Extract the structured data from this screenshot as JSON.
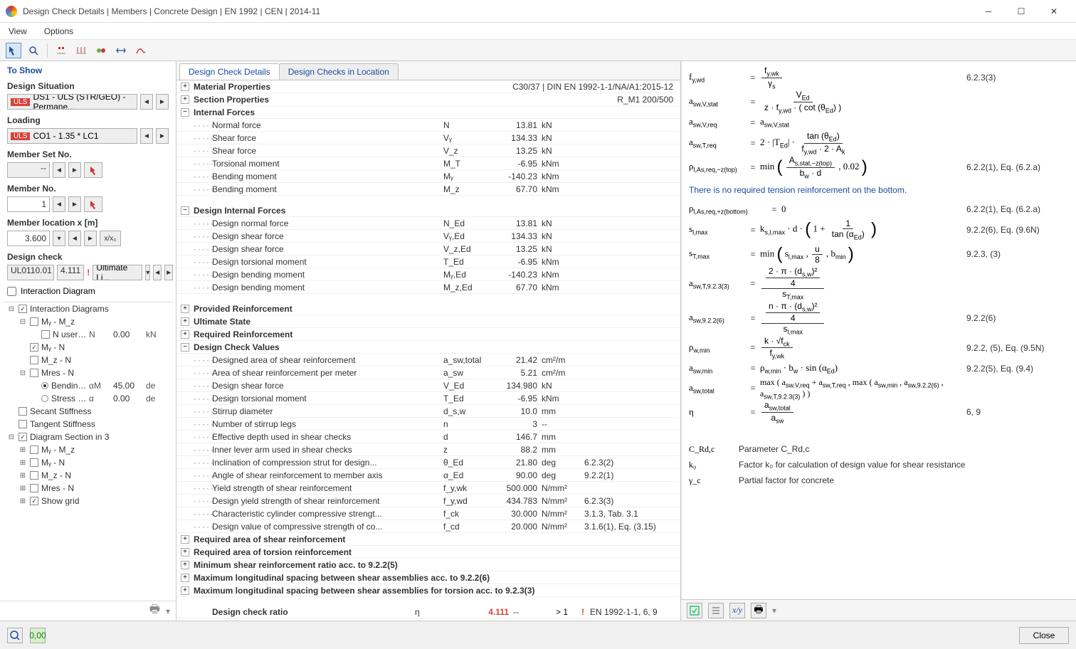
{
  "window": {
    "title": "Design Check Details | Members | Concrete Design | EN 1992 | CEN | 2014-11",
    "menu": {
      "view": "View",
      "options": "Options"
    },
    "close_label": "Close"
  },
  "left": {
    "header": "To Show",
    "design_situation_label": "Design Situation",
    "ds_badge": "ULS",
    "ds_value": "DS1 - ULS (STR/GEO) - Permane...",
    "loading_label": "Loading",
    "co_badge": "ULS",
    "co_value": "CO1 - 1.35 * LC1",
    "member_set_label": "Member Set No.",
    "member_set_value": "--",
    "member_no_label": "Member No.",
    "member_no_value": "1",
    "member_loc_label": "Member location x [m]",
    "member_loc_value": "3.600",
    "member_loc_btn": "x/x₀",
    "design_check_label": "Design check",
    "dc_code": "UL0110.01",
    "dc_ratio": "4.111",
    "dc_type": "Ultimate Li...",
    "interaction_label": "Interaction Diagram",
    "tree": [
      {
        "indent": 0,
        "exp": "-",
        "cbx": "checked",
        "label": "Interaction Diagrams"
      },
      {
        "indent": 1,
        "exp": "-",
        "cbx": "",
        "label": "Mᵧ - M_z"
      },
      {
        "indent": 2,
        "exp": "",
        "cbx": "",
        "label": "N user-defined",
        "c1": "N",
        "c2": "0.00",
        "c3": "kN"
      },
      {
        "indent": 1,
        "exp": "",
        "cbx": "checked",
        "label": "Mᵧ - N"
      },
      {
        "indent": 1,
        "exp": "",
        "cbx": "",
        "label": "M_z - N"
      },
      {
        "indent": 1,
        "exp": "-",
        "cbx": "",
        "label": "Mres - N"
      },
      {
        "indent": 2,
        "exp": "",
        "rad": "checked",
        "label": "Bending mom",
        "c1": "αM",
        "c2": "45.00",
        "c3": "de"
      },
      {
        "indent": 2,
        "exp": "",
        "rad": "",
        "label": "Stress plane a",
        "c1": "α",
        "c2": "0.00",
        "c3": "de"
      },
      {
        "indent": 0,
        "exp": "",
        "cbx": "",
        "label": "Secant Stiffness"
      },
      {
        "indent": 0,
        "exp": "",
        "cbx": "",
        "label": "Tangent Stiffness"
      },
      {
        "indent": 0,
        "exp": "-",
        "cbx": "checked",
        "label": "Diagram Section in 3"
      },
      {
        "indent": 1,
        "exp": "+",
        "cbx": "",
        "label": "Mᵧ - M_z"
      },
      {
        "indent": 1,
        "exp": "+",
        "cbx": "",
        "label": "Mᵧ - N"
      },
      {
        "indent": 1,
        "exp": "+",
        "cbx": "",
        "label": "M_z - N"
      },
      {
        "indent": 1,
        "exp": "+",
        "cbx": "",
        "label": "Mres - N"
      },
      {
        "indent": 1,
        "exp": "+",
        "cbx": "checked",
        "label": "Show grid"
      }
    ]
  },
  "mid": {
    "tabs": {
      "t1": "Design Check Details",
      "t2": "Design Checks in Location"
    },
    "hdr_material": "Material Properties",
    "hdr_material_info": "C30/37 | DIN EN 1992-1-1/NA/A1:2015-12",
    "hdr_section": "Section Properties",
    "hdr_section_info": "R_M1 200/500",
    "hdr_internal": "Internal Forces",
    "internal": [
      {
        "name": "Normal force",
        "sym": "N",
        "val": "13.81",
        "unit": "kN",
        "ref": ""
      },
      {
        "name": "Shear force",
        "sym": "Vᵧ",
        "val": "134.33",
        "unit": "kN",
        "ref": ""
      },
      {
        "name": "Shear force",
        "sym": "V_z",
        "val": "13.25",
        "unit": "kN",
        "ref": ""
      },
      {
        "name": "Torsional moment",
        "sym": "M_T",
        "val": "-6.95",
        "unit": "kNm",
        "ref": ""
      },
      {
        "name": "Bending moment",
        "sym": "Mᵧ",
        "val": "-140.23",
        "unit": "kNm",
        "ref": ""
      },
      {
        "name": "Bending moment",
        "sym": "M_z",
        "val": "67.70",
        "unit": "kNm",
        "ref": ""
      }
    ],
    "hdr_design_internal": "Design Internal Forces",
    "design_internal": [
      {
        "name": "Design normal force",
        "sym": "N_Ed",
        "val": "13.81",
        "unit": "kN",
        "ref": ""
      },
      {
        "name": "Design shear force",
        "sym": "Vᵧ,Ed",
        "val": "134.33",
        "unit": "kN",
        "ref": ""
      },
      {
        "name": "Design shear force",
        "sym": "V_z,Ed",
        "val": "13.25",
        "unit": "kN",
        "ref": ""
      },
      {
        "name": "Design torsional moment",
        "sym": "T_Ed",
        "val": "-6.95",
        "unit": "kNm",
        "ref": ""
      },
      {
        "name": "Design bending moment",
        "sym": "Mᵧ,Ed",
        "val": "-140.23",
        "unit": "kNm",
        "ref": ""
      },
      {
        "name": "Design bending moment",
        "sym": "M_z,Ed",
        "val": "67.70",
        "unit": "kNm",
        "ref": ""
      }
    ],
    "hdr_provided": "Provided Reinforcement",
    "hdr_ultimate": "Ultimate State",
    "hdr_required": "Required Reinforcement",
    "hdr_values": "Design Check Values",
    "values": [
      {
        "name": "Designed area of shear reinforcement",
        "sym": "a_sw,total",
        "val": "21.42",
        "unit": "cm²/m",
        "ref": ""
      },
      {
        "name": "Area of shear reinforcement per meter",
        "sym": "a_sw",
        "val": "5.21",
        "unit": "cm²/m",
        "ref": ""
      },
      {
        "name": "Design shear force",
        "sym": "V_Ed",
        "val": "134.980",
        "unit": "kN",
        "ref": ""
      },
      {
        "name": "Design torsional moment",
        "sym": "T_Ed",
        "val": "-6.95",
        "unit": "kNm",
        "ref": ""
      },
      {
        "name": "Stirrup diameter",
        "sym": "d_s,w",
        "val": "10.0",
        "unit": "mm",
        "ref": ""
      },
      {
        "name": "Number of stirrup legs",
        "sym": "n",
        "val": "3",
        "unit": "--",
        "ref": ""
      },
      {
        "name": "Effective depth used in shear checks",
        "sym": "d",
        "val": "146.7",
        "unit": "mm",
        "ref": ""
      },
      {
        "name": "Inner lever arm used in shear checks",
        "sym": "z",
        "val": "88.2",
        "unit": "mm",
        "ref": ""
      },
      {
        "name": "Inclination of compression strut for design...",
        "sym": "θ_Ed",
        "val": "21.80",
        "unit": "deg",
        "ref": "6.2.3(2)"
      },
      {
        "name": "Angle of shear reinforcement to member axis",
        "sym": "α_Ed",
        "val": "90.00",
        "unit": "deg",
        "ref": "9.2.2(1)"
      },
      {
        "name": "Yield strength of shear reinforcement",
        "sym": "f_y,wk",
        "val": "500.000",
        "unit": "N/mm²",
        "ref": ""
      },
      {
        "name": "Design yield strength of shear reinforcement",
        "sym": "f_y,wd",
        "val": "434.783",
        "unit": "N/mm²",
        "ref": "6.2.3(3)"
      },
      {
        "name": "Characteristic cylinder compressive strengt...",
        "sym": "f_ck",
        "val": "30.000",
        "unit": "N/mm²",
        "ref": "3.1.3, Tab. 3.1"
      },
      {
        "name": "Design value of compressive strength of co...",
        "sym": "f_cd",
        "val": "20.000",
        "unit": "N/mm²",
        "ref": "3.1.6(1), Eq. (3.15)"
      }
    ],
    "hdr_req_shear": "Required area of shear reinforcement",
    "hdr_req_torsion": "Required area of torsion reinforcement",
    "hdr_min_shear": "Minimum shear reinforcement ratio acc. to 9.2.2(5)",
    "hdr_max_long1": "Maximum longitudinal spacing between shear assemblies acc. to 9.2.2(6)",
    "hdr_max_long2": "Maximum longitudinal spacing between shear assemblies for torsion acc. to 9.2.3(3)",
    "ratio_row": {
      "name": "Design check ratio",
      "sym": "η",
      "val": "4.111",
      "unit": "--",
      "flag": "> 1",
      "extra": "!",
      "ref": "EN 1992-1-1, 6, 9"
    }
  },
  "right": {
    "rows": [
      {
        "lhs": "f_y,wd",
        "eq": "=",
        "rhs_html": "f_y,wk / γ_s",
        "ref": "6.2.3(3)"
      },
      {
        "lhs": "a_sw,V,stat",
        "eq": "=",
        "rhs_html": "V_Ed / ( z · f_y,wd · ( cot(θ_Ed) ) )",
        "ref": ""
      },
      {
        "lhs": "a_sw,V,req",
        "eq": "=",
        "rhs_html": "a_sw,V,stat",
        "ref": ""
      },
      {
        "lhs": "a_sw,T,req",
        "eq": "=",
        "rhs_html": "2 · |T_Ed| · tan(θ_Ed) / ( f_y,wd · 2 · A_k )",
        "ref": ""
      },
      {
        "lhs": "ρ_l,As,req,-z(top)",
        "eq": "=",
        "rhs_html": "min ( A_s,stat,-z(top) / ( b_w · d ) , 0.02 )",
        "ref": "6.2.2(1), Eq. (6.2.a)"
      }
    ],
    "note": "There is no required tension reinforcement on the bottom.",
    "rows2": [
      {
        "lhs": "ρ_l,As,req,+z(bottom)",
        "eq": "=",
        "rhs_html": "0",
        "ref": "6.2.2(1), Eq. (6.2.a)"
      },
      {
        "lhs": "s_l,max",
        "eq": "=",
        "rhs_html": "k_s,l,max · d · ( 1 + 1 / tan(α_Ed) )",
        "ref": "9.2.2(6), Eq. (9.6N)"
      },
      {
        "lhs": "s_T,max",
        "eq": "=",
        "rhs_html": "min ( s_l,max , u/8 , b_min )",
        "ref": "9.2.3, (3)"
      },
      {
        "lhs": "a_sw,T,9.2.3(3)",
        "eq": "=",
        "rhs_html": "( 2 · π · (d_s,w)² / 4 ) / s_T,max",
        "ref": ""
      },
      {
        "lhs": "a_sw,9.2.2(6)",
        "eq": "=",
        "rhs_html": "( n · π · (d_s,w)² / 4 ) / s_l,max",
        "ref": "9.2.2(6)"
      },
      {
        "lhs": "ρ_w,min",
        "eq": "=",
        "rhs_html": "k · √f_ck / f_y,wk",
        "ref": "9.2.2, (5), Eq. (9.5N)"
      },
      {
        "lhs": "a_sw,min",
        "eq": "=",
        "rhs_html": "ρ_w,min · b_w · sin(α_Ed)",
        "ref": "9.2.2(5), Eq. (9.4)"
      },
      {
        "lhs": "a_sw,total",
        "eq": "=",
        "rhs_html": "max ( a_sw,V,req + a_sw,T,req , max ( a_sw,min , a_sw,9.2.2(6) , a_sw,T,9.2.3(3) ) )",
        "ref": ""
      },
      {
        "lhs": "η",
        "eq": "=",
        "rhs_html": "a_sw,total / a_sw",
        "ref": "6, 9"
      }
    ],
    "defs": [
      {
        "sym": "C_Rd,c",
        "txt": "Parameter C_Rd,c"
      },
      {
        "sym": "k₀",
        "txt": "Factor k₀ for calculation of design value for shear resistance"
      },
      {
        "sym": "γ_c",
        "txt": "Partial factor for concrete"
      }
    ]
  }
}
